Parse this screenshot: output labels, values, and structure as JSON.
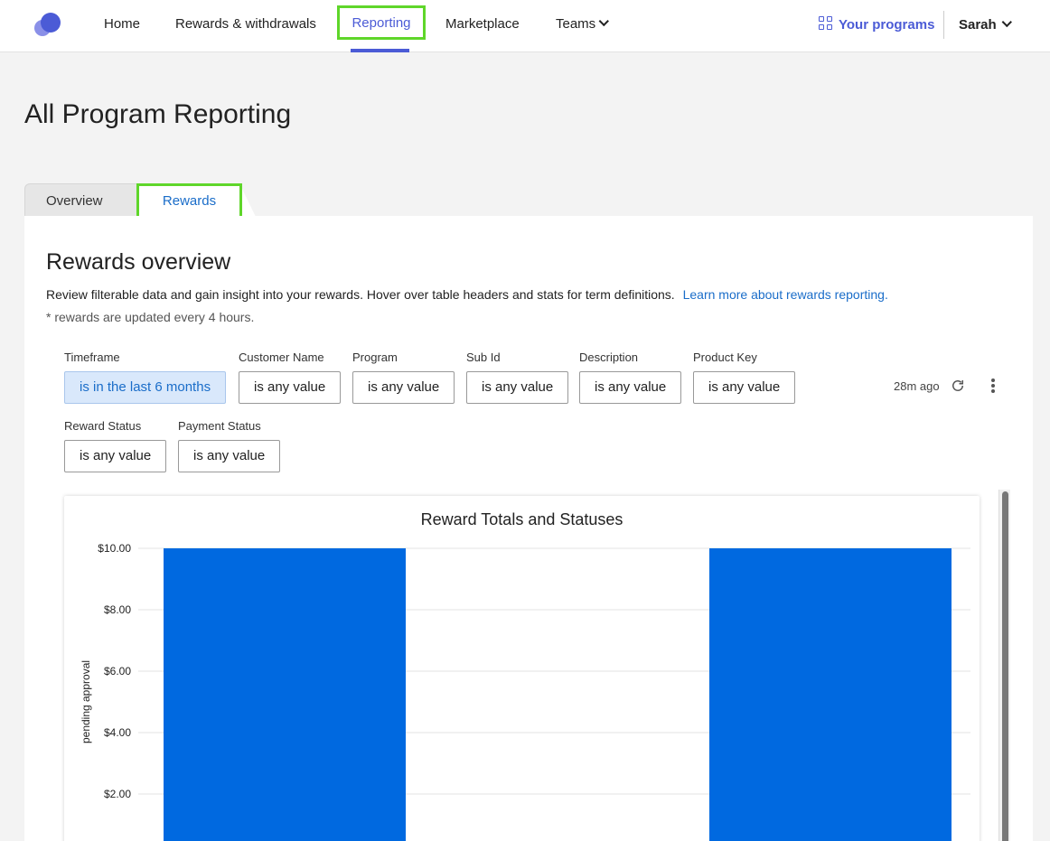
{
  "nav": {
    "items": [
      {
        "label": "Home"
      },
      {
        "label": "Rewards & withdrawals"
      },
      {
        "label": "Reporting"
      },
      {
        "label": "Marketplace"
      },
      {
        "label": "Teams"
      }
    ],
    "your_programs": "Your programs",
    "user": "Sarah"
  },
  "page": {
    "title": "All Program Reporting",
    "tabs": [
      {
        "label": "Overview"
      },
      {
        "label": "Rewards"
      }
    ]
  },
  "rewards": {
    "title": "Rewards overview",
    "description": "Review filterable data and gain insight into your rewards. Hover over table headers and stats for term definitions.",
    "learn_more": "Learn more about rewards reporting.",
    "note": "* rewards are updated every 4 hours.",
    "filters": [
      {
        "label": "Timeframe",
        "value": "is in the last 6 months",
        "active": true
      },
      {
        "label": "Customer Name",
        "value": "is any value"
      },
      {
        "label": "Program",
        "value": "is any value"
      },
      {
        "label": "Sub Id",
        "value": "is any value"
      },
      {
        "label": "Description",
        "value": "is any value"
      },
      {
        "label": "Product Key",
        "value": "is any value"
      },
      {
        "label": "Reward Status",
        "value": "is any value"
      },
      {
        "label": "Payment Status",
        "value": "is any value"
      }
    ],
    "last_refresh": "28m ago"
  },
  "colors": {
    "brand": "#4b5bd6",
    "highlight": "#5fd62a",
    "link": "#1a6dc9",
    "bar": "#0069e0"
  },
  "chart_data": {
    "type": "bar",
    "title": "Reward Totals and Statuses",
    "ylabel": "pending approval",
    "xlabel": "",
    "ylim": [
      0,
      10
    ],
    "yticks": [
      "$10.00",
      "$8.00",
      "$6.00",
      "$4.00",
      "$2.00"
    ],
    "series": [
      {
        "values": [
          10,
          10
        ]
      }
    ],
    "grid": true
  }
}
